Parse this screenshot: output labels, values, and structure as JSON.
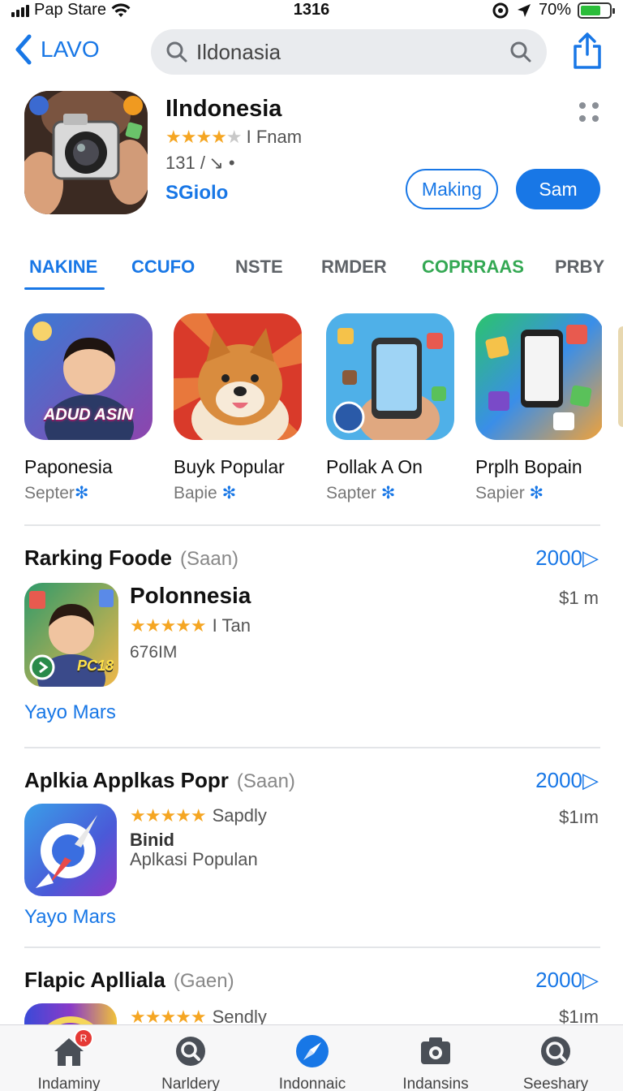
{
  "status_bar": {
    "carrier": "Pap Stare",
    "time": "1316",
    "battery": "70%",
    "battery_level": 0.7
  },
  "nav": {
    "back_label": "LAVO",
    "search_value": "Ildonasia"
  },
  "app": {
    "title": "Ilndonesia",
    "rating_stars": 3.5,
    "rating_label": "I Fnam",
    "meta": "131 / ↘ •",
    "developer": "SGiolo",
    "secondary_button": "Making",
    "primary_button": "Sam"
  },
  "tabs": [
    {
      "label": "NAKINE",
      "state": "active"
    },
    {
      "label": "CCUFO",
      "state": "blue"
    },
    {
      "label": "NSTE",
      "state": "normal"
    },
    {
      "label": "RMDER",
      "state": "normal"
    },
    {
      "label": "COPRRAAS",
      "state": "green"
    },
    {
      "label": "PRBY",
      "state": "normal"
    }
  ],
  "carousel": [
    {
      "name": "Paponesia",
      "sub": "Septer",
      "thumb_text": "ADUD ASIN",
      "icon": "boy-portrait-icon"
    },
    {
      "name": "Buyk Popular",
      "sub": "Bapie",
      "icon": "shiba-dog-icon"
    },
    {
      "name": "Pollak A On",
      "sub": "Sapter",
      "icon": "phone-in-hand-icon"
    },
    {
      "name": "Prplh Bopain",
      "sub": "Sapier",
      "icon": "phone-collage-icon"
    }
  ],
  "sections": [
    {
      "title": "Rarking Foode",
      "title_tag": "(Saan)",
      "more": "2000▷",
      "app_name": "Polonnesia",
      "stars": 4.5,
      "stars_label": "I Tan",
      "line1": "676IM",
      "price": "$1 m",
      "link": "Yayo Mars",
      "icon_text": "PC18"
    },
    {
      "title": "Aplkia Applkas Popr",
      "title_tag": "(Saan)",
      "more": "2000▷",
      "stars": 4.5,
      "stars_label": "Sapdly",
      "bold_line": "Binid",
      "line1": "Aplkasi Populan",
      "price": "$1ım",
      "link": "Yayo Mars"
    },
    {
      "title": "Flapic Apllialа",
      "title_tag": "(Gaen)",
      "more": "2000▷",
      "stars": 4.5,
      "stars_label": "Sendly",
      "price": "$1ım"
    }
  ],
  "tabbar": [
    {
      "label": "Indaminy",
      "icon": "home-icon",
      "badge": "R"
    },
    {
      "label": "Narldery",
      "icon": "search-round-icon"
    },
    {
      "label": "Indonnaic",
      "icon": "compass-icon"
    },
    {
      "label": "Indansins",
      "icon": "camera-icon"
    },
    {
      "label": "Seeshary",
      "icon": "magnifier-icon"
    }
  ],
  "colors": {
    "accent": "#1877e6",
    "star": "#f5a623",
    "green_tab": "#34a853"
  }
}
